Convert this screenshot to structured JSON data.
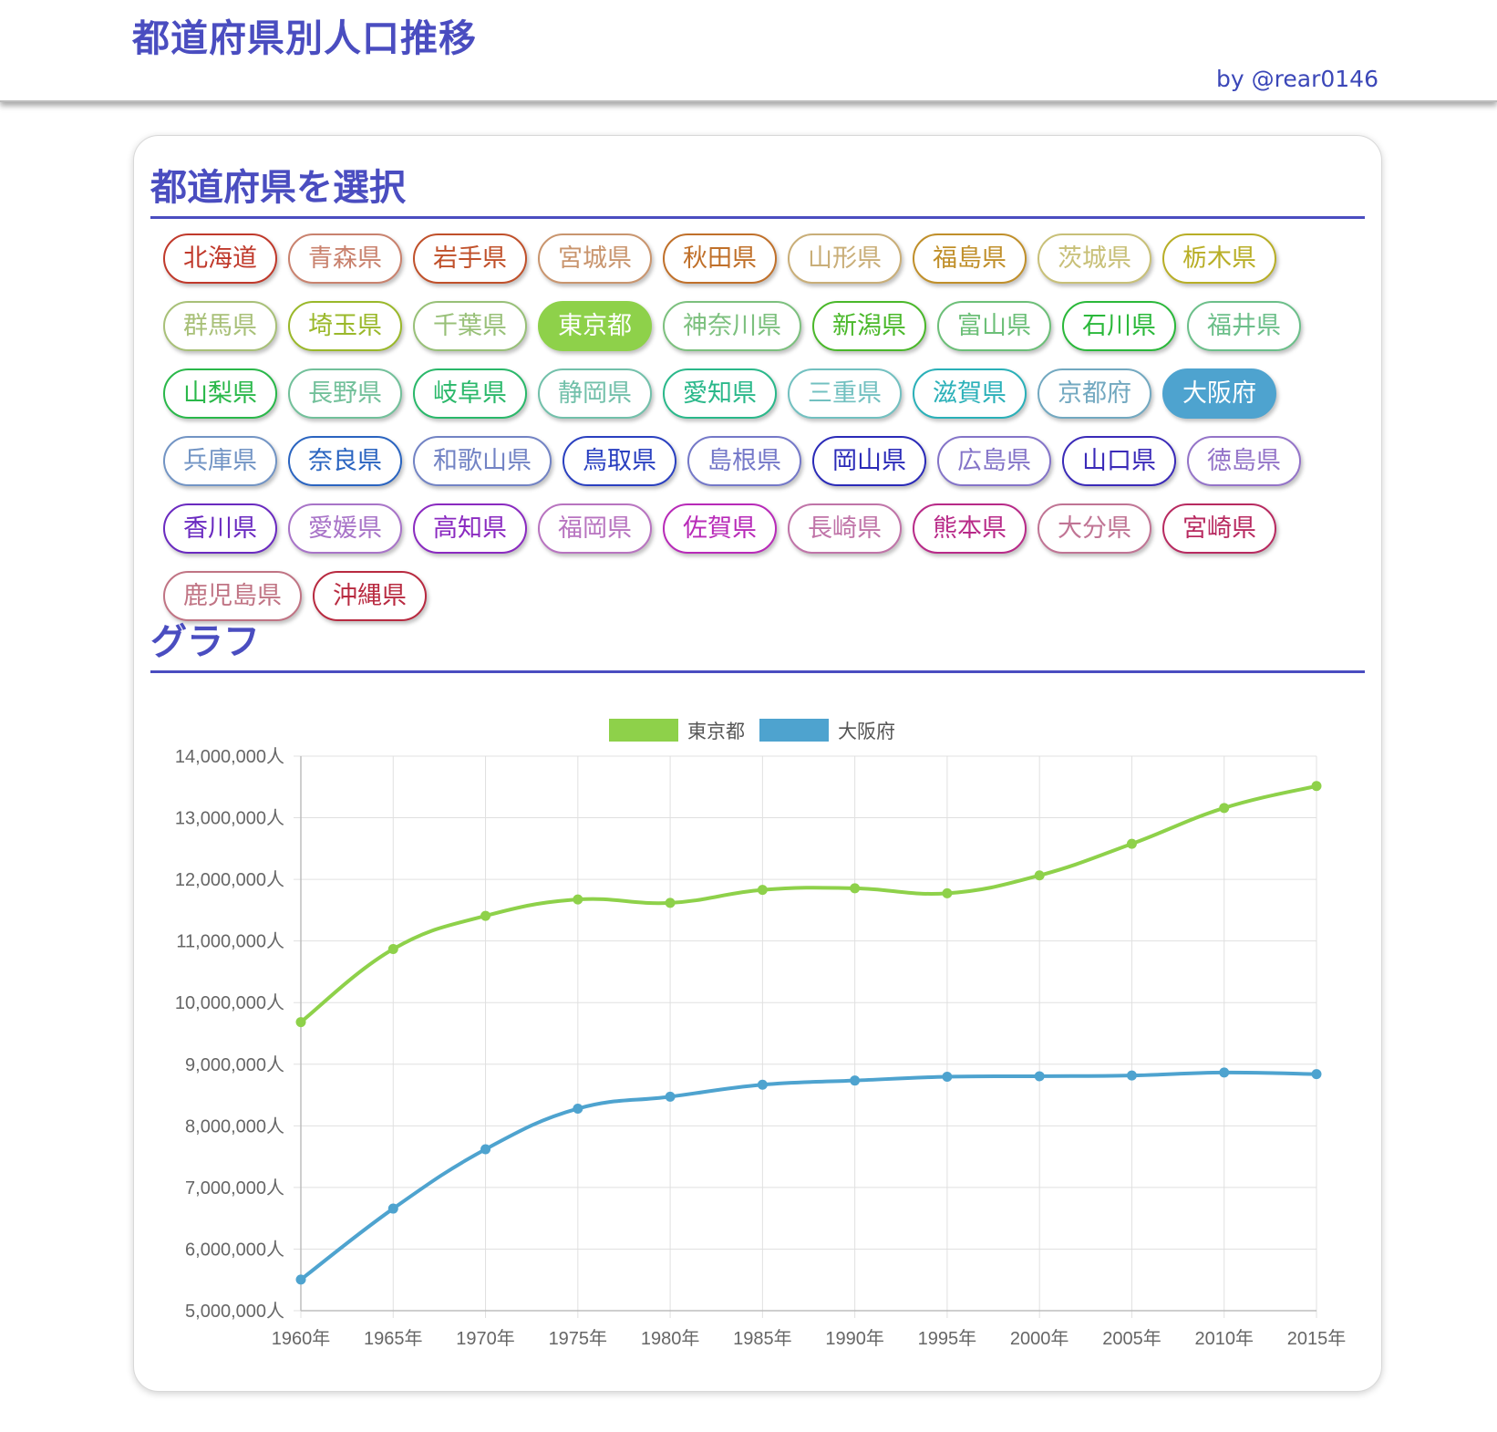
{
  "header": {
    "title": "都道府県別人口推移",
    "author": "by @rear0146"
  },
  "select_section": {
    "title": "都道府県を選択"
  },
  "graph_section": {
    "title": "グラフ"
  },
  "prefectures": [
    {
      "label": "北海道",
      "color": "#c0392b",
      "selected": false
    },
    {
      "label": "青森県",
      "color": "#c9826e",
      "selected": false
    },
    {
      "label": "岩手県",
      "color": "#c0502a",
      "selected": false
    },
    {
      "label": "宮城県",
      "color": "#c9956e",
      "selected": false
    },
    {
      "label": "秋田県",
      "color": "#c0702a",
      "selected": false
    },
    {
      "label": "山形県",
      "color": "#c9ae78",
      "selected": false
    },
    {
      "label": "福島県",
      "color": "#c08f2a",
      "selected": false
    },
    {
      "label": "茨城県",
      "color": "#c8c078",
      "selected": false
    },
    {
      "label": "栃木県",
      "color": "#b8ae26",
      "selected": false
    },
    {
      "label": "群馬県",
      "color": "#a8c078",
      "selected": false
    },
    {
      "label": "埼玉県",
      "color": "#9ab82a",
      "selected": false
    },
    {
      "label": "千葉県",
      "color": "#98c078",
      "selected": false
    },
    {
      "label": "東京都",
      "color": "#8ed14a",
      "selected": true
    },
    {
      "label": "神奈川県",
      "color": "#7cc07e",
      "selected": false
    },
    {
      "label": "新潟県",
      "color": "#4ab82a",
      "selected": false
    },
    {
      "label": "富山県",
      "color": "#6cbf78",
      "selected": false
    },
    {
      "label": "石川県",
      "color": "#2ab83a",
      "selected": false
    },
    {
      "label": "福井県",
      "color": "#6cbf8a",
      "selected": false
    },
    {
      "label": "山梨県",
      "color": "#2ab84a",
      "selected": false
    },
    {
      "label": "長野県",
      "color": "#72c09a",
      "selected": false
    },
    {
      "label": "岐阜県",
      "color": "#2ab86a",
      "selected": false
    },
    {
      "label": "静岡県",
      "color": "#72c0aa",
      "selected": false
    },
    {
      "label": "愛知県",
      "color": "#2ab88a",
      "selected": false
    },
    {
      "label": "三重県",
      "color": "#72c0c0",
      "selected": false
    },
    {
      "label": "滋賀県",
      "color": "#2ab0b8",
      "selected": false
    },
    {
      "label": "京都府",
      "color": "#72a8c0",
      "selected": false
    },
    {
      "label": "大阪府",
      "color": "#4ea3cf",
      "selected": true
    },
    {
      "label": "兵庫県",
      "color": "#7294c4",
      "selected": false
    },
    {
      "label": "奈良県",
      "color": "#2a64c0",
      "selected": false
    },
    {
      "label": "和歌山県",
      "color": "#7283c4",
      "selected": false
    },
    {
      "label": "鳥取県",
      "color": "#2a40c0",
      "selected": false
    },
    {
      "label": "島根県",
      "color": "#7478c8",
      "selected": false
    },
    {
      "label": "岡山県",
      "color": "#2a2ab8",
      "selected": false
    },
    {
      "label": "広島県",
      "color": "#8474c8",
      "selected": false
    },
    {
      "label": "山口県",
      "color": "#3a2ab8",
      "selected": false
    },
    {
      "label": "徳島県",
      "color": "#9474c8",
      "selected": false
    },
    {
      "label": "香川県",
      "color": "#6a2ac0",
      "selected": false
    },
    {
      "label": "愛媛県",
      "color": "#a874c8",
      "selected": false
    },
    {
      "label": "高知県",
      "color": "#8a2ac0",
      "selected": false
    },
    {
      "label": "福岡県",
      "color": "#b874c0",
      "selected": false
    },
    {
      "label": "佐賀県",
      "color": "#b82ab8",
      "selected": false
    },
    {
      "label": "長崎県",
      "color": "#c074a8",
      "selected": false
    },
    {
      "label": "熊本県",
      "color": "#b82a88",
      "selected": false
    },
    {
      "label": "大分県",
      "color": "#c07494",
      "selected": false
    },
    {
      "label": "宮崎県",
      "color": "#b82a60",
      "selected": false
    },
    {
      "label": "鹿児島県",
      "color": "#c07484",
      "selected": false
    },
    {
      "label": "沖縄県",
      "color": "#b82a40",
      "selected": false
    }
  ],
  "chart_data": {
    "type": "line",
    "title": "",
    "xlabel": "",
    "ylabel": "",
    "categories": [
      "1960年",
      "1965年",
      "1970年",
      "1975年",
      "1980年",
      "1985年",
      "1990年",
      "1995年",
      "2000年",
      "2005年",
      "2010年",
      "2015年"
    ],
    "ylim": [
      5000000,
      14000000
    ],
    "yticks": [
      {
        "value": 14000000,
        "label": "14,000,000人"
      },
      {
        "value": 13000000,
        "label": "13,000,000人"
      },
      {
        "value": 12000000,
        "label": "12,000,000人"
      },
      {
        "value": 11000000,
        "label": "11,000,000人"
      },
      {
        "value": 10000000,
        "label": "10,000,000人"
      },
      {
        "value": 9000000,
        "label": "9,000,000人"
      },
      {
        "value": 8000000,
        "label": "8,000,000人"
      },
      {
        "value": 7000000,
        "label": "7,000,000人"
      },
      {
        "value": 6000000,
        "label": "6,000,000人"
      },
      {
        "value": 5000000,
        "label": "5,000,000人"
      }
    ],
    "grid": true,
    "legend_position": "top",
    "series": [
      {
        "name": "東京都",
        "color": "#8ed14a",
        "values": [
          9684000,
          10869000,
          11408000,
          11674000,
          11618000,
          11829000,
          11856000,
          11774000,
          12064000,
          12577000,
          13159000,
          13515000
        ]
      },
      {
        "name": "大阪府",
        "color": "#4ea3cf",
        "values": [
          5505000,
          6657000,
          7620000,
          8279000,
          8473000,
          8668000,
          8735000,
          8797000,
          8805000,
          8817000,
          8865000,
          8839000
        ]
      }
    ]
  }
}
